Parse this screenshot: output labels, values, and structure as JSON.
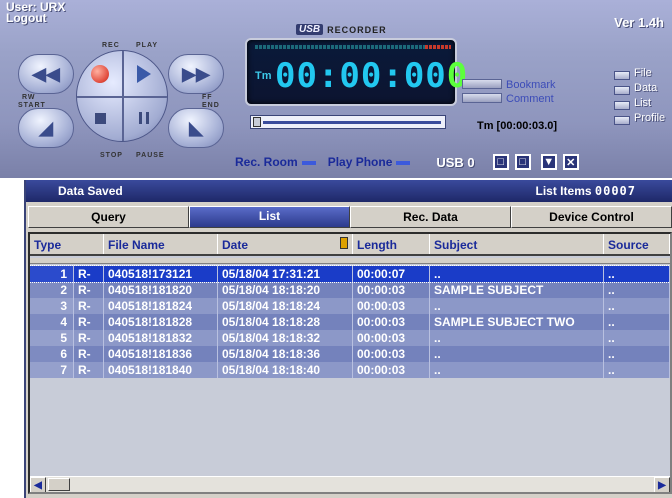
{
  "header": {
    "user": "User: URX",
    "logout": "Logout",
    "version": "Ver 1.4h"
  },
  "logo": {
    "usb": "USB",
    "recorder": "RECORDER"
  },
  "controls": {
    "rec": "REC",
    "play": "PLAY",
    "rw": "RW",
    "start": "START",
    "ff": "FF",
    "end": "END",
    "stop": "STOP",
    "pause": "PAUSE"
  },
  "display": {
    "tm": "Tm",
    "time_main": "00:00:00",
    "time_last": "0"
  },
  "bookmark": {
    "bookmark_label": "Bookmark",
    "comment_label": "Comment",
    "tm_readout": "Tm [00:00:03.0]"
  },
  "checks": [
    {
      "label": "File"
    },
    {
      "label": "Data"
    },
    {
      "label": "List"
    },
    {
      "label": "Profile"
    }
  ],
  "strip": {
    "rec_room": "Rec. Room",
    "play_phone": "Play Phone",
    "usb_label": "USB 0"
  },
  "data_panel": {
    "title": "Data Saved",
    "list_items_label": "List Items",
    "list_items_count": "00007"
  },
  "tabs": [
    "Query",
    "List",
    "Rec. Data",
    "Device Control"
  ],
  "active_tab": "List",
  "grid": {
    "headers": [
      "Type",
      "File Name",
      "Date",
      "Length",
      "Subject",
      "Source"
    ],
    "rows": [
      {
        "n": "1",
        "type": "R-",
        "file": "040518!173121",
        "date": "05/18/04 17:31:21",
        "length": "00:00:07",
        "subject": "..",
        "source": "..",
        "selected": true
      },
      {
        "n": "2",
        "type": "R-",
        "file": "040518!181820",
        "date": "05/18/04 18:18:20",
        "length": "00:00:03",
        "subject": "SAMPLE SUBJECT",
        "source": ".."
      },
      {
        "n": "3",
        "type": "R-",
        "file": "040518!181824",
        "date": "05/18/04 18:18:24",
        "length": "00:00:03",
        "subject": "..",
        "source": ".."
      },
      {
        "n": "4",
        "type": "R-",
        "file": "040518!181828",
        "date": "05/18/04 18:18:28",
        "length": "00:00:03",
        "subject": "SAMPLE SUBJECT TWO",
        "source": ".."
      },
      {
        "n": "5",
        "type": "R-",
        "file": "040518!181832",
        "date": "05/18/04 18:18:32",
        "length": "00:00:03",
        "subject": "..",
        "source": ".."
      },
      {
        "n": "6",
        "type": "R-",
        "file": "040518!181836",
        "date": "05/18/04 18:18:36",
        "length": "00:00:03",
        "subject": "..",
        "source": ".."
      },
      {
        "n": "7",
        "type": "R-",
        "file": "040518!181840",
        "date": "05/18/04 18:18:40",
        "length": "00:00:03",
        "subject": "..",
        "source": ".."
      }
    ]
  },
  "colors": {
    "accent": "#1a2a9a",
    "selected_row": "#1a3cc8",
    "time_digits": "#22c8f0",
    "time_last_digit": "#5cff3c"
  }
}
